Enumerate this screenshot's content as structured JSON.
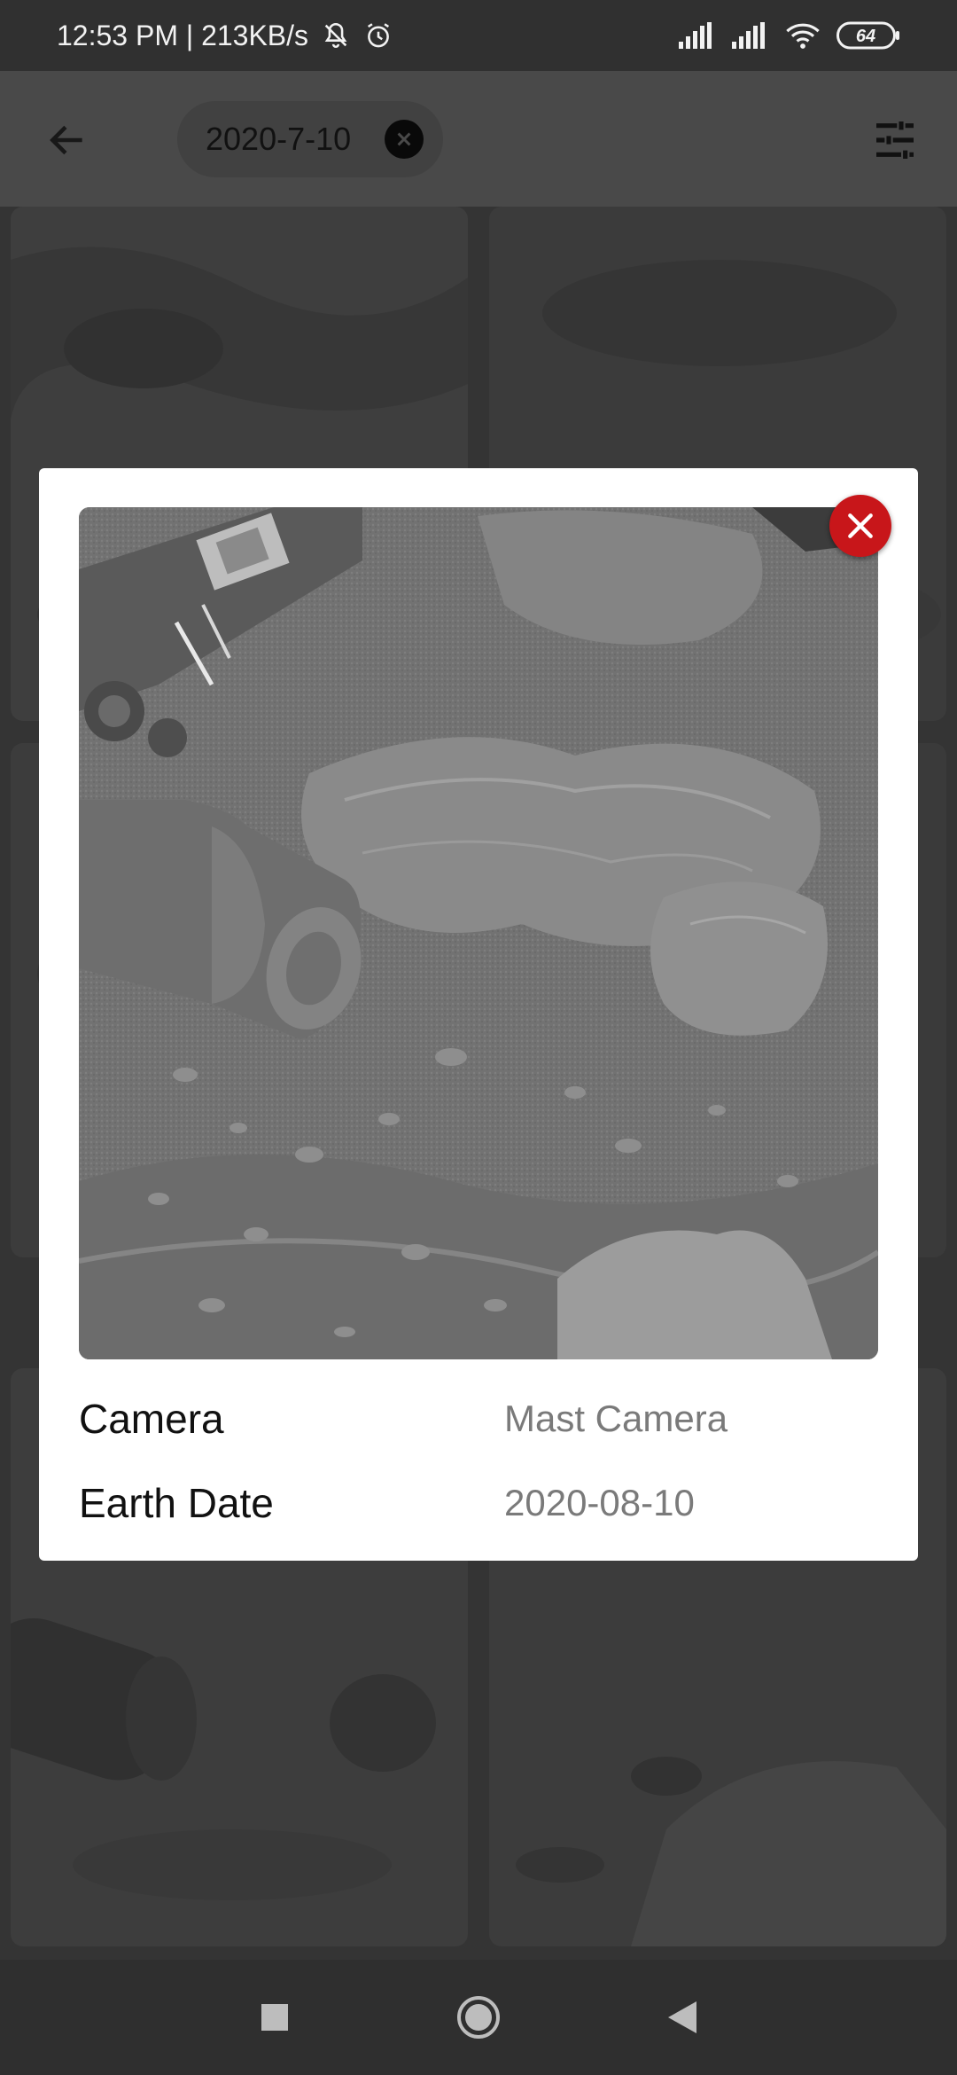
{
  "status_bar": {
    "time_and_speed": "12:53 PM | 213KB/s",
    "battery_level": "64",
    "icons": [
      "bell-off-icon",
      "alarm-icon",
      "signal-icon",
      "signal-icon",
      "wifi-icon",
      "battery-icon"
    ]
  },
  "app_bar": {
    "back_icon": "arrow-left-icon",
    "filter_chip_label": "2020-7-10",
    "chip_clear_icon": "close-icon",
    "filter_icon": "tune-sliders-icon"
  },
  "dialog": {
    "close_icon": "close-icon",
    "accent_color": "#c8161a",
    "camera_label": "Camera",
    "camera_value": "Mast Camera",
    "date_label": "Earth Date",
    "date_value": "2020-08-10"
  },
  "nav_bar": {
    "icons": [
      "square-recents-icon",
      "circle-home-icon",
      "triangle-back-icon"
    ]
  }
}
